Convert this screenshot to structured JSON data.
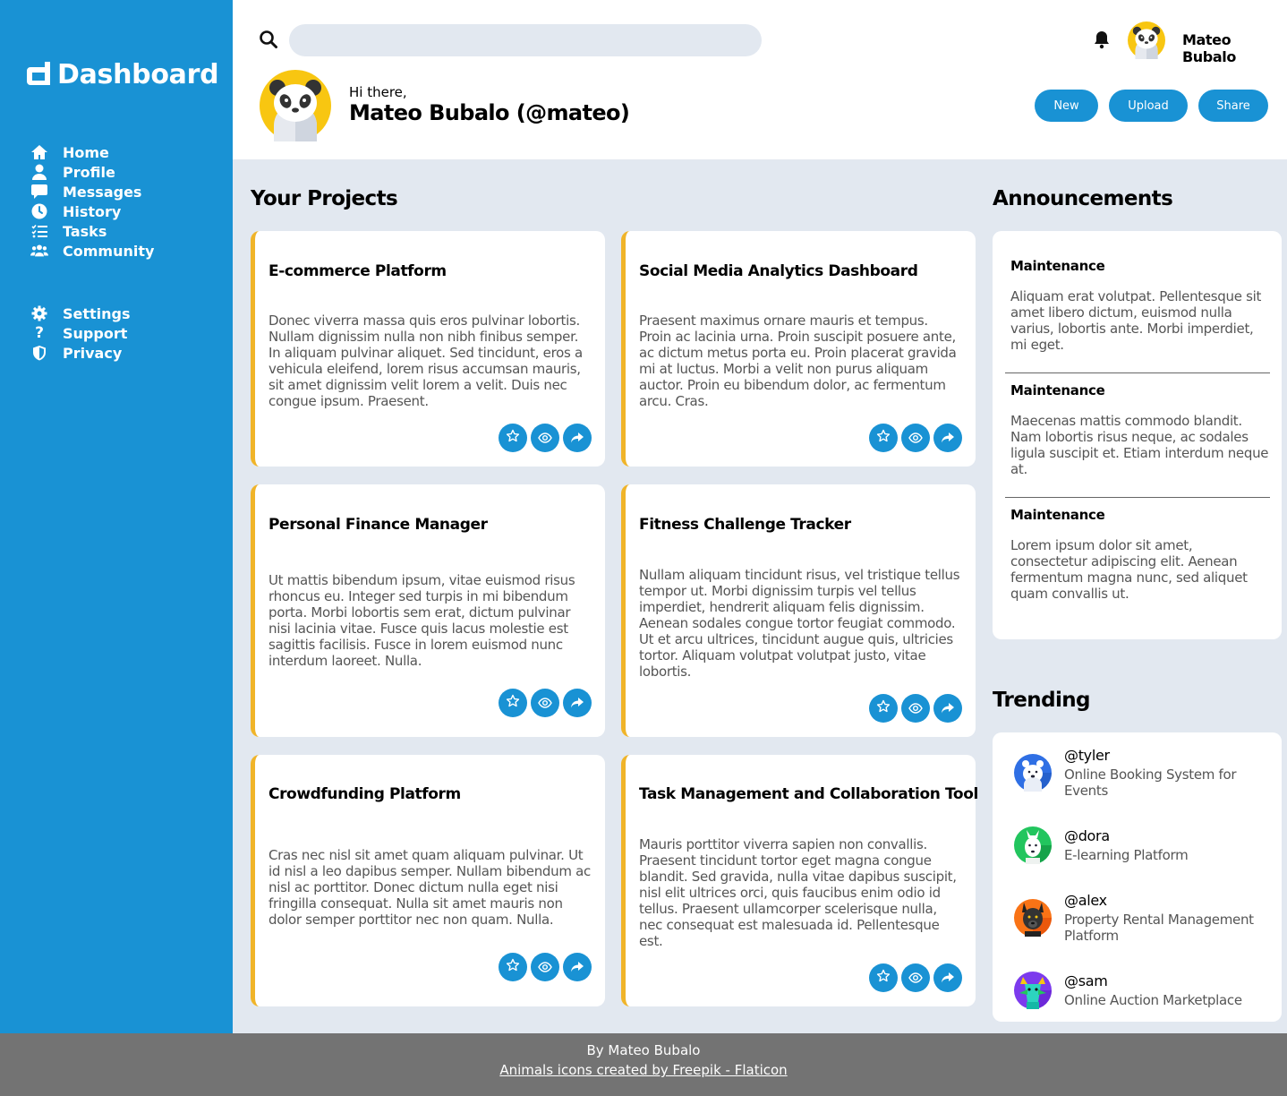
{
  "sidebar": {
    "brand": "Dashboard",
    "main_nav": [
      {
        "label": "Home",
        "icon": "home-icon"
      },
      {
        "label": "Profile",
        "icon": "user-icon"
      },
      {
        "label": "Messages",
        "icon": "chat-icon"
      },
      {
        "label": "History",
        "icon": "clock-icon"
      },
      {
        "label": "Tasks",
        "icon": "tasks-icon"
      },
      {
        "label": "Community",
        "icon": "users-icon"
      }
    ],
    "secondary_nav": [
      {
        "label": "Settings",
        "icon": "gear-icon"
      },
      {
        "label": "Support",
        "icon": "question-icon"
      },
      {
        "label": "Privacy",
        "icon": "shield-icon"
      }
    ]
  },
  "header": {
    "search_placeholder": "",
    "username": "Mateo Bubalo",
    "greeting": "Hi there,",
    "display_name": "Mateo Bubalo (@mateo)",
    "actions": {
      "new": "New",
      "upload": "Upload",
      "share": "Share"
    }
  },
  "projects": {
    "title": "Your Projects",
    "items": [
      {
        "title": "E-commerce Platform",
        "description": "Donec viverra massa quis eros pulvinar lobortis. Nullam dignissim nulla non nibh finibus semper. In aliquam pulvinar aliquet. Sed tincidunt, eros a vehicula eleifend, lorem risus accumsan mauris, sit amet dignissim velit lorem a velit. Duis nec congue ipsum. Praesent."
      },
      {
        "title": "Social Media Analytics Dashboard",
        "description": "Praesent maximus ornare mauris et tempus. Proin ac lacinia urna. Proin suscipit posuere ante, ac dictum metus porta eu. Proin placerat gravida mi at luctus. Morbi a velit non purus aliquam auctor. Proin eu bibendum dolor, ac fermentum arcu. Cras."
      },
      {
        "title": "Personal Finance Manager",
        "description": "Ut mattis bibendum ipsum, vitae euismod risus rhoncus eu. Integer sed turpis in mi bibendum porta. Morbi lobortis sem erat, dictum pulvinar nisi lacinia vitae. Fusce quis lacus molestie est sagittis facilisis. Fusce in lorem euismod nunc interdum laoreet. Nulla."
      },
      {
        "title": "Fitness Challenge Tracker",
        "description": "Nullam aliquam tincidunt risus, vel tristique tellus tempor ut. Morbi dignissim turpis vel tellus imperdiet, hendrerit aliquam felis dignissim. Aenean sodales congue tortor feugiat commodo. Ut et arcu ultrices, tincidunt augue quis, ultricies tortor. Aliquam volutpat volutpat justo, vitae lobortis."
      },
      {
        "title": "Crowdfunding Platform",
        "description": "Cras nec nisl sit amet quam aliquam pulvinar. Ut id nisl a leo dapibus semper. Nullam bibendum ac nisl ac porttitor. Donec dictum nulla eget nisi fringilla consequat. Nulla sit amet mauris non dolor semper porttitor nec non quam. Nulla."
      },
      {
        "title": "Task Management and Collaboration Tool",
        "description": "Mauris porttitor viverra sapien non convallis. Praesent tincidunt tortor eget magna congue blandit. Sed gravida, nulla vitae dapibus suscipit, nisl elit ultrices orci, quis faucibus enim odio id tellus. Praesent ullamcorper scelerisque nulla, nec consequat est malesuada id. Pellentesque est."
      }
    ]
  },
  "announcements": {
    "title": "Announcements",
    "items": [
      {
        "title": "Maintenance",
        "text": "Aliquam erat volutpat. Pellentesque sit amet libero dictum, euismod nulla varius, lobortis ante. Morbi imperdiet, mi eget."
      },
      {
        "title": "Maintenance",
        "text": "Maecenas mattis commodo blandit. Nam lobortis risus neque, ac sodales ligula suscipit et. Etiam interdum neque at."
      },
      {
        "title": "Maintenance",
        "text": "Lorem ipsum dolor sit amet, consectetur adipiscing elit. Aenean fermentum magna nunc, sed aliquet quam convallis ut."
      }
    ]
  },
  "trending": {
    "title": "Trending",
    "items": [
      {
        "handle": "@tyler",
        "project": "Online Booking System for Events",
        "avatar": "polar-bear-avatar",
        "color": "#2f6fe4"
      },
      {
        "handle": "@dora",
        "project": "E-learning Platform",
        "avatar": "llama-avatar",
        "color": "#22c55e"
      },
      {
        "handle": "@alex",
        "project": "Property Rental Management Platform",
        "avatar": "dog-avatar",
        "color": "#f97316"
      },
      {
        "handle": "@sam",
        "project": "Online Auction Marketplace",
        "avatar": "dragon-avatar",
        "color": "#7c3aed"
      }
    ]
  },
  "footer": {
    "by": "By Mateo Bubalo",
    "credit": "Animals icons created by Freepik - Flaticon"
  },
  "colors": {
    "accent": "#1992d4",
    "card_border": "#f0b429",
    "background": "#e2e8f0",
    "footer": "#737373"
  }
}
